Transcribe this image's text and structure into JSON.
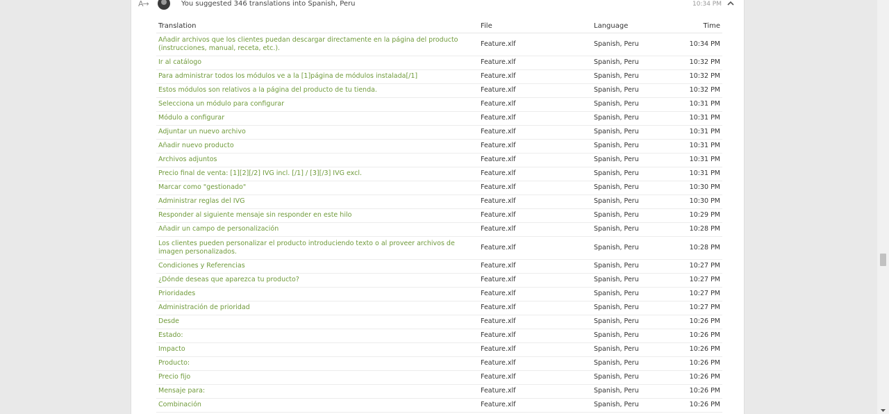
{
  "activity": {
    "summary": "You suggested 346 translations into Spanish, Peru",
    "time": "10:34 PM",
    "icon": "translate-icon",
    "collapse_icon": "chevron-up-icon"
  },
  "table": {
    "headers": {
      "translation": "Translation",
      "file": "File",
      "language": "Language",
      "time": "Time"
    },
    "rows": [
      {
        "translation": "Añadir archivos que los clientes puedan descargar directamente en la página del producto (instrucciones, manual, receta, etc.).",
        "file": "Feature.xlf",
        "language": "Spanish, Peru",
        "time": "10:34 PM"
      },
      {
        "translation": "Ir al catálogo",
        "file": "Feature.xlf",
        "language": "Spanish, Peru",
        "time": "10:32 PM"
      },
      {
        "translation": "Para administrar todos los módulos ve a la [1]página de módulos instalada[/1]",
        "file": "Feature.xlf",
        "language": "Spanish, Peru",
        "time": "10:32 PM"
      },
      {
        "translation": "Estos módulos son relativos a la página del producto de tu tienda.",
        "file": "Feature.xlf",
        "language": "Spanish, Peru",
        "time": "10:32 PM"
      },
      {
        "translation": "Selecciona un módulo para configurar",
        "file": "Feature.xlf",
        "language": "Spanish, Peru",
        "time": "10:31 PM"
      },
      {
        "translation": "Módulo a configurar",
        "file": "Feature.xlf",
        "language": "Spanish, Peru",
        "time": "10:31 PM"
      },
      {
        "translation": "Adjuntar un nuevo archivo",
        "file": "Feature.xlf",
        "language": "Spanish, Peru",
        "time": "10:31 PM"
      },
      {
        "translation": "Añadir nuevo producto",
        "file": "Feature.xlf",
        "language": "Spanish, Peru",
        "time": "10:31 PM"
      },
      {
        "translation": "Archivos adjuntos",
        "file": "Feature.xlf",
        "language": "Spanish, Peru",
        "time": "10:31 PM"
      },
      {
        "translation": "Precio final de venta: [1][2][/2] IVG incl. [/1] / [3][/3] IVG excl.",
        "file": "Feature.xlf",
        "language": "Spanish, Peru",
        "time": "10:31 PM"
      },
      {
        "translation": "Marcar como \"gestionado\"",
        "file": "Feature.xlf",
        "language": "Spanish, Peru",
        "time": "10:30 PM"
      },
      {
        "translation": "Administrar reglas del IVG",
        "file": "Feature.xlf",
        "language": "Spanish, Peru",
        "time": "10:30 PM"
      },
      {
        "translation": "Responder al siguiente mensaje sin responder en este hilo",
        "file": "Feature.xlf",
        "language": "Spanish, Peru",
        "time": "10:29 PM"
      },
      {
        "translation": "Añadir un campo de personalización",
        "file": "Feature.xlf",
        "language": "Spanish, Peru",
        "time": "10:28 PM"
      },
      {
        "translation": "Los clientes pueden personalizar el producto introduciendo texto o al proveer archivos de imagen personalizados.",
        "file": "Feature.xlf",
        "language": "Spanish, Peru",
        "time": "10:28 PM"
      },
      {
        "translation": "Condiciones y Referencias",
        "file": "Feature.xlf",
        "language": "Spanish, Peru",
        "time": "10:27 PM"
      },
      {
        "translation": "¿Dónde deseas que aparezca tu producto?",
        "file": "Feature.xlf",
        "language": "Spanish, Peru",
        "time": "10:27 PM"
      },
      {
        "translation": "Prioridades",
        "file": "Feature.xlf",
        "language": "Spanish, Peru",
        "time": "10:27 PM"
      },
      {
        "translation": "Administración de prioridad",
        "file": "Feature.xlf",
        "language": "Spanish, Peru",
        "time": "10:27 PM"
      },
      {
        "translation": "Desde",
        "file": "Feature.xlf",
        "language": "Spanish, Peru",
        "time": "10:26 PM"
      },
      {
        "translation": "Estado:",
        "file": "Feature.xlf",
        "language": "Spanish, Peru",
        "time": "10:26 PM"
      },
      {
        "translation": "Impacto",
        "file": "Feature.xlf",
        "language": "Spanish, Peru",
        "time": "10:26 PM"
      },
      {
        "translation": "Producto:",
        "file": "Feature.xlf",
        "language": "Spanish, Peru",
        "time": "10:26 PM"
      },
      {
        "translation": "Precio fijo",
        "file": "Feature.xlf",
        "language": "Spanish, Peru",
        "time": "10:26 PM"
      },
      {
        "translation": "Mensaje para:",
        "file": "Feature.xlf",
        "language": "Spanish, Peru",
        "time": "10:26 PM"
      },
      {
        "translation": "Combinación",
        "file": "Feature.xlf",
        "language": "Spanish, Peru",
        "time": "10:26 PM"
      }
    ]
  },
  "colors": {
    "link": "#6f9a3a",
    "text": "#333333",
    "background": "#e9e9e9"
  }
}
